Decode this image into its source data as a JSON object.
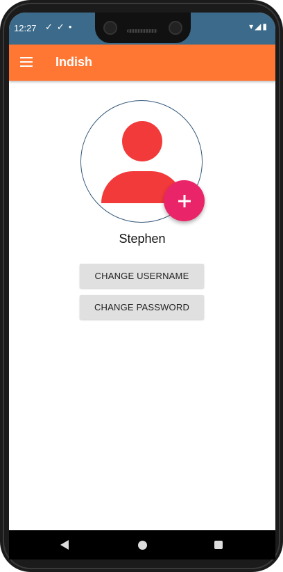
{
  "status_bar": {
    "time": "12:27",
    "left_icons": [
      "check-icon",
      "check-icon",
      "dot-icon"
    ],
    "right_icons": [
      "wifi-icon",
      "signal-icon",
      "battery-icon"
    ]
  },
  "app_bar": {
    "title": "Indish",
    "color": "#ff7733"
  },
  "profile": {
    "username": "Stephen",
    "avatar_color": "#f23a3a",
    "add_button_color": "#ea2468"
  },
  "actions": {
    "change_username_label": "CHANGE USERNAME",
    "change_password_label": "CHANGE PASSWORD"
  },
  "nav_bar": {
    "icons": [
      "back-icon",
      "home-icon",
      "recents-icon"
    ]
  }
}
